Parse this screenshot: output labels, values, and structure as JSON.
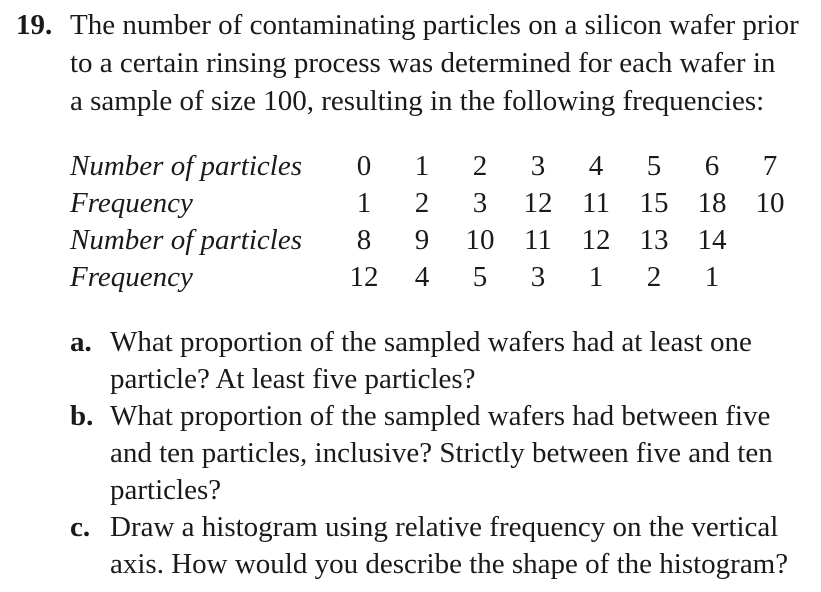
{
  "problem": {
    "number": "19.",
    "intro_lines": [
      "The number of contaminating particles on a silicon wafer prior",
      "to a certain rinsing process was determined for each wafer in",
      "a sample of size 100, resulting in the following frequencies:"
    ]
  },
  "table": {
    "rows": [
      {
        "label": "Number of particles",
        "values": [
          "0",
          "1",
          "2",
          "3",
          "4",
          "5",
          "6",
          "7"
        ]
      },
      {
        "label": "Frequency",
        "values": [
          "1",
          "2",
          "3",
          "12",
          "11",
          "15",
          "18",
          "10"
        ]
      },
      {
        "label": "Number of particles",
        "values": [
          "8",
          "9",
          "10",
          "11",
          "12",
          "13",
          "14",
          ""
        ]
      },
      {
        "label": "Frequency",
        "values": [
          "12",
          "4",
          "5",
          "3",
          "1",
          "2",
          "1",
          ""
        ]
      }
    ]
  },
  "parts": [
    {
      "letter": "a.",
      "lines": [
        "What proportion of the sampled wafers had at least one",
        "particle? At least five particles?"
      ]
    },
    {
      "letter": "b.",
      "lines": [
        "What proportion of the sampled wafers had between five",
        "and ten particles, inclusive? Strictly between five and ten",
        "particles?"
      ]
    },
    {
      "letter": "c.",
      "lines": [
        "Draw a histogram using relative frequency on the vertical",
        "axis. How would you describe the shape of the histogram?"
      ]
    }
  ]
}
